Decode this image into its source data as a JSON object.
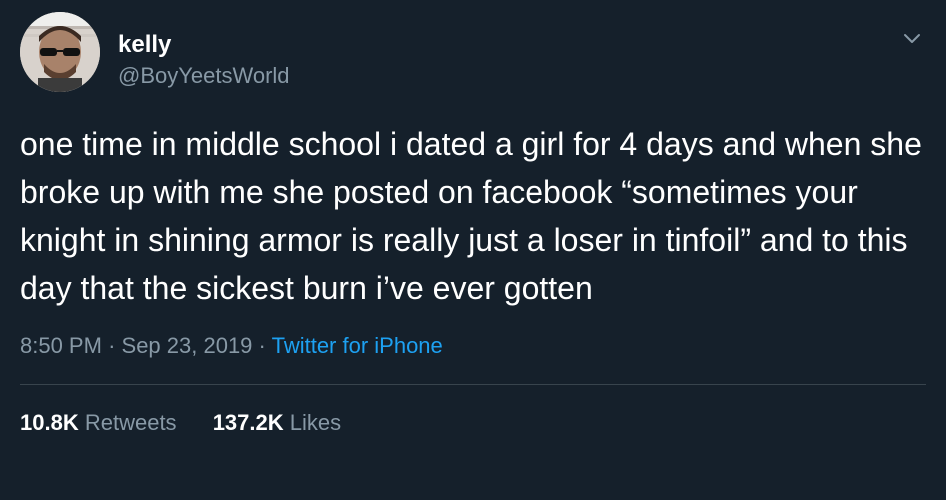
{
  "author": {
    "display_name": "kelly",
    "handle": "@BoyYeetsWorld"
  },
  "tweet": {
    "text": "one time in middle school i dated a girl for 4 days and when she broke up with me she posted on facebook “sometimes your knight in shining armor is really just a loser in tinfoil” and to this day that the sickest burn i’ve ever gotten",
    "time": "8:50 PM",
    "separator": "·",
    "date": "Sep 23, 2019",
    "source": "Twitter for iPhone"
  },
  "stats": {
    "retweets_count": "10.8K",
    "retweets_label": "Retweets",
    "likes_count": "137.2K",
    "likes_label": "Likes"
  },
  "icons": {
    "menu": "chevron-down-icon"
  },
  "colors": {
    "background": "#15202b",
    "secondary_text": "#8899a6",
    "link": "#1da1f2"
  }
}
